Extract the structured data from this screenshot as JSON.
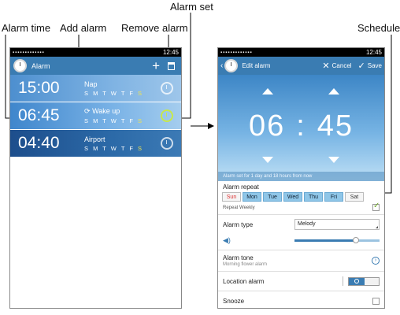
{
  "callouts": {
    "alarm_time": "Alarm time",
    "add_alarm": "Add alarm",
    "remove_alarm": "Remove alarm",
    "alarm_set": "Alarm set",
    "schedule": "Schedule"
  },
  "status_bar": {
    "time": "12:45"
  },
  "alarm_list": {
    "title": "Alarm",
    "add_icon": "plus-icon",
    "remove_icon": "trash-icon",
    "alarms": [
      {
        "time": "15:00",
        "name": "Nap",
        "days_weekday": "S M T W T F",
        "days_weekend": "S",
        "active": false
      },
      {
        "time": "06:45",
        "name": "Wake up",
        "days_weekday": "S M T W T F",
        "days_weekend": "S",
        "active": true
      },
      {
        "time": "04:40",
        "name": "Airport",
        "days_weekday": "S M T W T F",
        "days_weekend": "S",
        "active": false
      }
    ],
    "repeat_glyph": "⟳"
  },
  "edit_alarm": {
    "title": "Edit alarm",
    "cancel": "Cancel",
    "save": "Save",
    "hour": "06",
    "colon": ":",
    "minute": "45",
    "note": "Alarm set for 1 day and 18 hours from now",
    "repeat_label": "Alarm repeat",
    "days": [
      {
        "label": "Sun",
        "on": false
      },
      {
        "label": "Mon",
        "on": true
      },
      {
        "label": "Tue",
        "on": true
      },
      {
        "label": "Wed",
        "on": true
      },
      {
        "label": "Thu",
        "on": true
      },
      {
        "label": "Fri",
        "on": true
      },
      {
        "label": "Sat",
        "on": false
      }
    ],
    "repeat_weekly": "Repeat Weekly",
    "repeat_weekly_checked": true,
    "alarm_type_label": "Alarm type",
    "alarm_type_value": "Melody",
    "volume_level": 0.72,
    "alarm_tone_label": "Alarm tone",
    "alarm_tone_value": "Morning flower alarm",
    "location_label": "Location alarm",
    "location_on": true,
    "snooze_label": "Snooze",
    "snooze_checked": false
  }
}
